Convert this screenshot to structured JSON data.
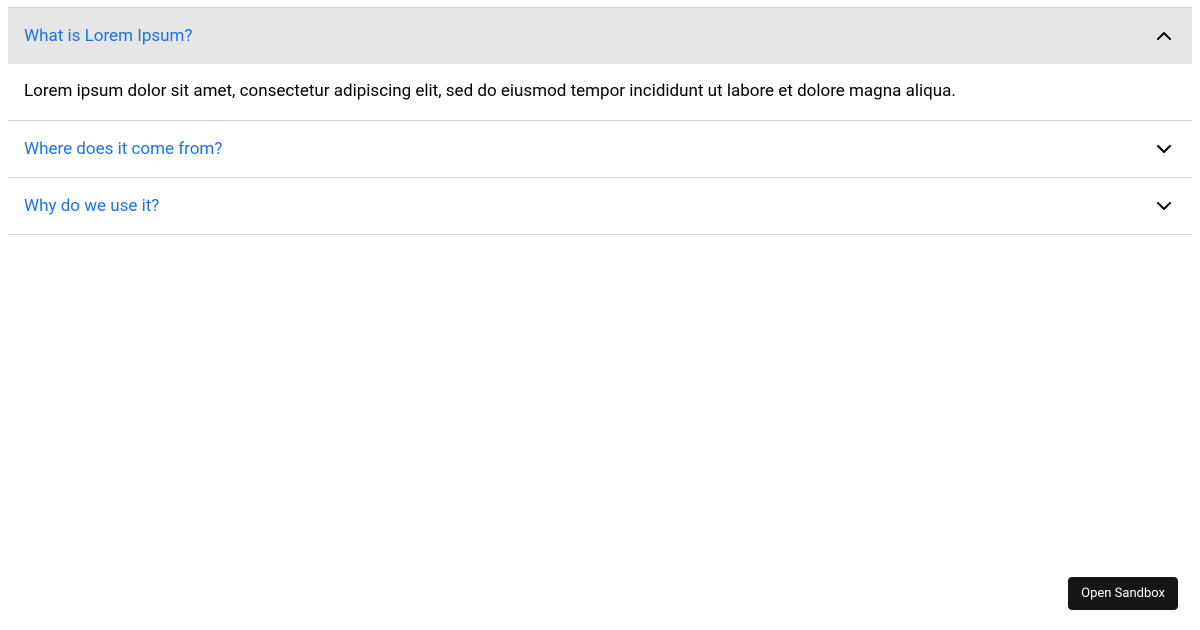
{
  "accordion": {
    "items": [
      {
        "title": "What is Lorem Ipsum?",
        "content": "Lorem ipsum dolor sit amet, consectetur adipiscing elit, sed do eiusmod tempor incididunt ut labore et dolore magna aliqua.",
        "expanded": true
      },
      {
        "title": "Where does it come from?",
        "expanded": false
      },
      {
        "title": "Why do we use it?",
        "expanded": false
      }
    ]
  },
  "sandbox_button": {
    "label": "Open Sandbox"
  }
}
